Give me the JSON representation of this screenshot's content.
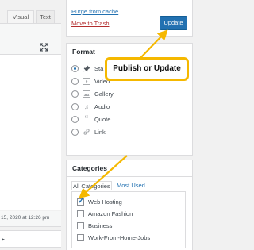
{
  "editor": {
    "tabs": [
      "Visual",
      "Text"
    ],
    "status_text": "15, 2020 at 12:26 pm"
  },
  "publish": {
    "purge_link": "Purge from cache",
    "trash_link": "Move to Trash",
    "update_button": "Update"
  },
  "format": {
    "title": "Format",
    "options": [
      {
        "label": "Sta",
        "icon": "pushpin-icon",
        "checked": true
      },
      {
        "label": "Video",
        "icon": "video-icon",
        "checked": false
      },
      {
        "label": "Gallery",
        "icon": "gallery-icon",
        "checked": false
      },
      {
        "label": "Audio",
        "icon": "audio-icon",
        "checked": false
      },
      {
        "label": "Quote",
        "icon": "quote-icon",
        "checked": false
      },
      {
        "label": "Link",
        "icon": "link-icon",
        "checked": false
      }
    ]
  },
  "categories": {
    "title": "Categories",
    "tab_all": "All Categories",
    "tab_used": "Most Used",
    "items": [
      {
        "label": "Web Hosting",
        "checked": true
      },
      {
        "label": "Amazon Fashion",
        "checked": false
      },
      {
        "label": "Business",
        "checked": false
      },
      {
        "label": "Work-From-Home-Jobs",
        "checked": false
      }
    ]
  },
  "annotation": {
    "callout_text": "Publish or Update"
  },
  "colors": {
    "accent": "#2271b1",
    "danger": "#b32d2e",
    "callout_border": "#f5b800"
  }
}
